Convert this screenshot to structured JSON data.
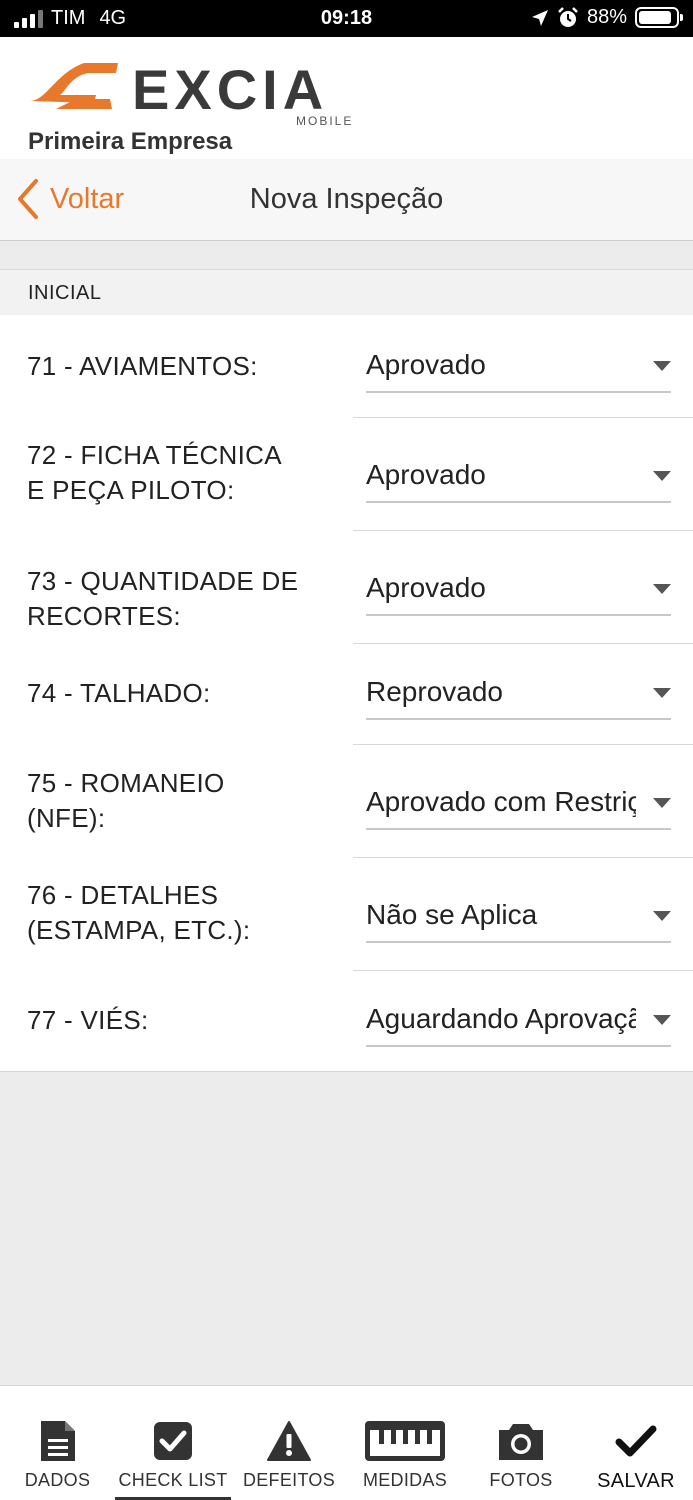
{
  "status_bar": {
    "carrier": "TIM",
    "network": "4G",
    "time": "09:18",
    "battery": "88%",
    "battery_level": 0.88
  },
  "header": {
    "brand_name": "EXCIA",
    "brand_sub": "MOBILE",
    "company": "Primeira Empresa"
  },
  "nav": {
    "back_label": "Voltar",
    "title": "Nova Inspeção"
  },
  "section": {
    "title": "INICIAL"
  },
  "checklist": {
    "items": [
      {
        "label_lines": [
          "71 - AVIAMENTOS:"
        ],
        "value": "Aprovado"
      },
      {
        "label_lines": [
          "72 - FICHA TÉCNICA",
          "E PEÇA PILOTO:"
        ],
        "value": "Aprovado"
      },
      {
        "label_lines": [
          "73 - QUANTIDADE DE",
          "RECORTES:"
        ],
        "value": "Aprovado"
      },
      {
        "label_lines": [
          "74 - TALHADO:"
        ],
        "value": "Reprovado"
      },
      {
        "label_lines": [
          "75 - ROMANEIO",
          "(NFE):"
        ],
        "value": "Aprovado com Restrição"
      },
      {
        "label_lines": [
          "76 - DETALHES",
          "(ESTAMPA, ETC.):"
        ],
        "value": "Não se Aplica"
      },
      {
        "label_lines": [
          "77 - VIÉS:"
        ],
        "value": "Aguardando Aprovação"
      }
    ]
  },
  "tabs": [
    {
      "label": "DADOS",
      "icon": "document-icon"
    },
    {
      "label": "CHECK LIST",
      "icon": "checkbox-icon",
      "active": true
    },
    {
      "label": "DEFEITOS",
      "icon": "warning-icon"
    },
    {
      "label": "MEDIDAS",
      "icon": "ruler-icon"
    },
    {
      "label": "FOTOS",
      "icon": "camera-icon"
    },
    {
      "label": "SALVAR",
      "icon": "checkmark-icon"
    }
  ],
  "colors": {
    "accent": "#e8792c",
    "brand_dark": "#3a3a3a",
    "background": "#ececec",
    "icon": "#333333"
  }
}
